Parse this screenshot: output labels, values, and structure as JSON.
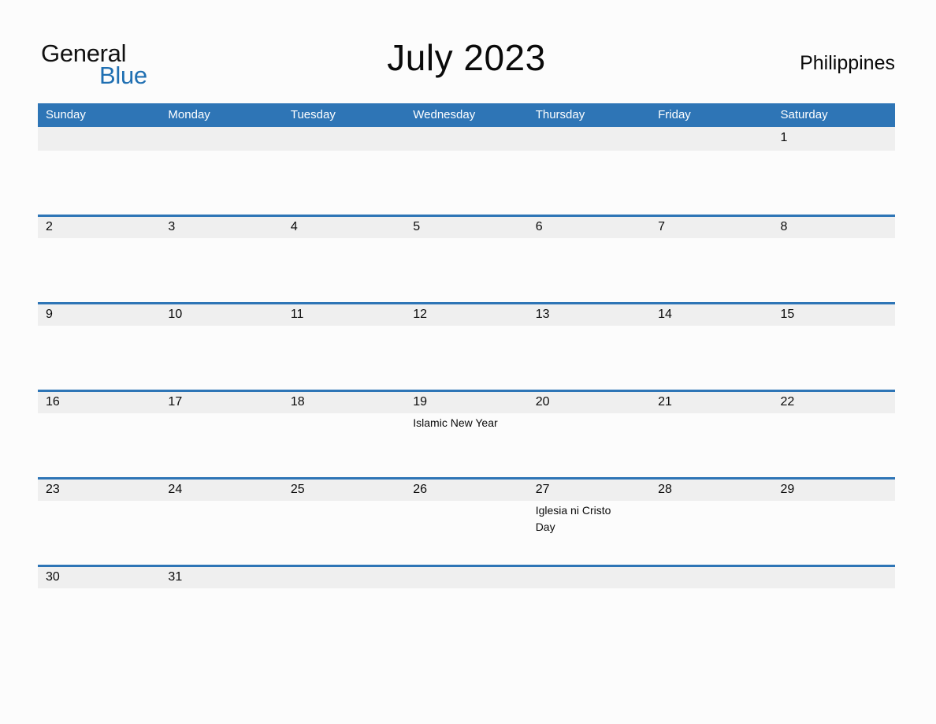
{
  "logo": {
    "word_one": "General",
    "word_two": "Blue",
    "triangle_color": "#1f6fb2",
    "text_color": "#111111"
  },
  "header": {
    "title": "July 2023",
    "country": "Philippines"
  },
  "theme": {
    "header_blue": "#2e75b6",
    "rule_blue": "#2e75b6",
    "band_gray": "#efefef",
    "page_background": "#fcfcfc",
    "text_color": "#0a0a0a"
  },
  "weekdays": [
    "Sunday",
    "Monday",
    "Tuesday",
    "Wednesday",
    "Thursday",
    "Friday",
    "Saturday"
  ],
  "weeks": [
    {
      "days": [
        {
          "number": "",
          "events": []
        },
        {
          "number": "",
          "events": []
        },
        {
          "number": "",
          "events": []
        },
        {
          "number": "",
          "events": []
        },
        {
          "number": "",
          "events": []
        },
        {
          "number": "",
          "events": []
        },
        {
          "number": "1",
          "events": []
        }
      ]
    },
    {
      "days": [
        {
          "number": "2",
          "events": []
        },
        {
          "number": "3",
          "events": []
        },
        {
          "number": "4",
          "events": []
        },
        {
          "number": "5",
          "events": []
        },
        {
          "number": "6",
          "events": []
        },
        {
          "number": "7",
          "events": []
        },
        {
          "number": "8",
          "events": []
        }
      ]
    },
    {
      "days": [
        {
          "number": "9",
          "events": []
        },
        {
          "number": "10",
          "events": []
        },
        {
          "number": "11",
          "events": []
        },
        {
          "number": "12",
          "events": []
        },
        {
          "number": "13",
          "events": []
        },
        {
          "number": "14",
          "events": []
        },
        {
          "number": "15",
          "events": []
        }
      ]
    },
    {
      "days": [
        {
          "number": "16",
          "events": []
        },
        {
          "number": "17",
          "events": []
        },
        {
          "number": "18",
          "events": []
        },
        {
          "number": "19",
          "events": [
            "Islamic New Year"
          ]
        },
        {
          "number": "20",
          "events": []
        },
        {
          "number": "21",
          "events": []
        },
        {
          "number": "22",
          "events": []
        }
      ]
    },
    {
      "days": [
        {
          "number": "23",
          "events": []
        },
        {
          "number": "24",
          "events": []
        },
        {
          "number": "25",
          "events": []
        },
        {
          "number": "26",
          "events": []
        },
        {
          "number": "27",
          "events": [
            "Iglesia ni Cristo",
            "Day"
          ]
        },
        {
          "number": "28",
          "events": []
        },
        {
          "number": "29",
          "events": []
        }
      ]
    },
    {
      "days": [
        {
          "number": "30",
          "events": []
        },
        {
          "number": "31",
          "events": []
        },
        {
          "number": "",
          "events": []
        },
        {
          "number": "",
          "events": []
        },
        {
          "number": "",
          "events": []
        },
        {
          "number": "",
          "events": []
        },
        {
          "number": "",
          "events": []
        }
      ]
    }
  ]
}
